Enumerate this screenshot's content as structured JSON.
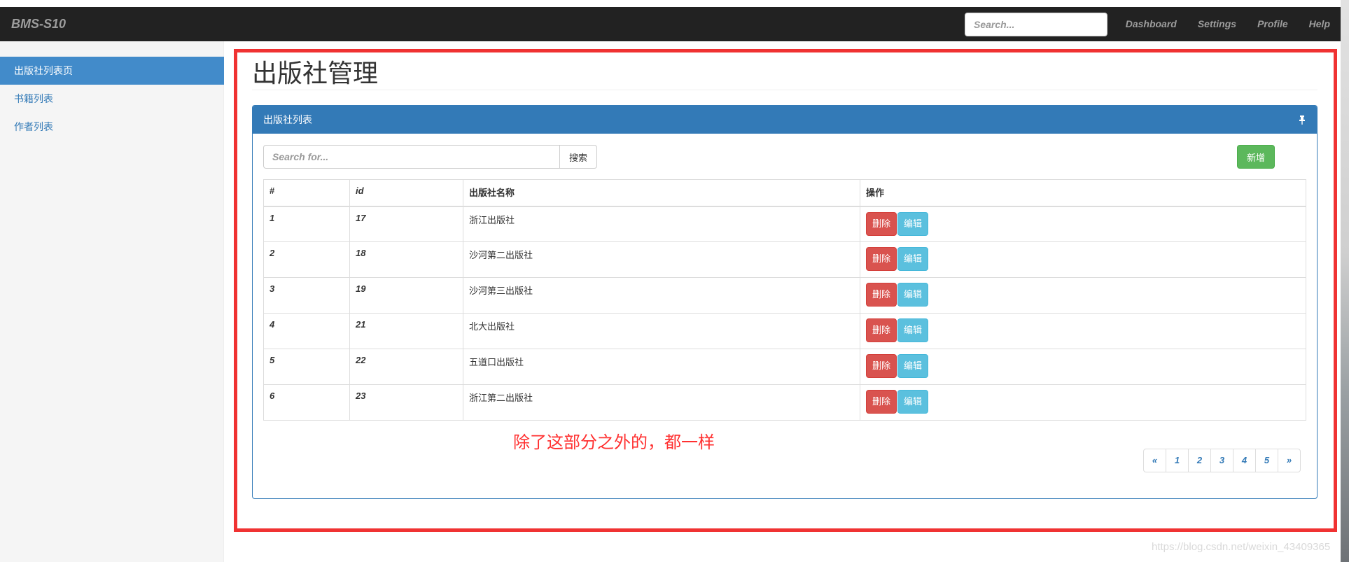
{
  "navbar": {
    "brand": "BMS-S10",
    "search_placeholder": "Search...",
    "links": [
      "Dashboard",
      "Settings",
      "Profile",
      "Help"
    ]
  },
  "sidebar": {
    "items": [
      {
        "label": "出版社列表页",
        "active": true
      },
      {
        "label": "书籍列表",
        "active": false
      },
      {
        "label": "作者列表",
        "active": false
      }
    ]
  },
  "main": {
    "title": "出版社管理",
    "panel_title": "出版社列表",
    "search_placeholder": "Search for...",
    "search_button": "搜索",
    "add_button": "新增"
  },
  "table": {
    "headers": [
      "#",
      "id",
      "出版社名称",
      "操作"
    ],
    "rows": [
      {
        "index": "1",
        "id": "17",
        "name": "浙江出版社"
      },
      {
        "index": "2",
        "id": "18",
        "name": "沙河第二出版社"
      },
      {
        "index": "3",
        "id": "19",
        "name": "沙河第三出版社"
      },
      {
        "index": "4",
        "id": "21",
        "name": "北大出版社"
      },
      {
        "index": "5",
        "id": "22",
        "name": "五道口出版社"
      },
      {
        "index": "6",
        "id": "23",
        "name": "浙江第二出版社"
      }
    ],
    "delete_label": "删除",
    "edit_label": "编辑"
  },
  "annotation": "除了这部分之外的，都一样",
  "pagination": [
    "«",
    "1",
    "2",
    "3",
    "4",
    "5",
    "»"
  ],
  "watermark": "https://blog.csdn.net/weixin_43409365",
  "colors": {
    "navbar": "#222222",
    "primary": "#337ab7",
    "active_sidebar": "#428bca",
    "danger": "#d9534f",
    "info": "#5bc0de",
    "success": "#5cb85c",
    "annotation_red": "#f03232"
  },
  "icons": {
    "panel_heading": "pin-icon"
  }
}
